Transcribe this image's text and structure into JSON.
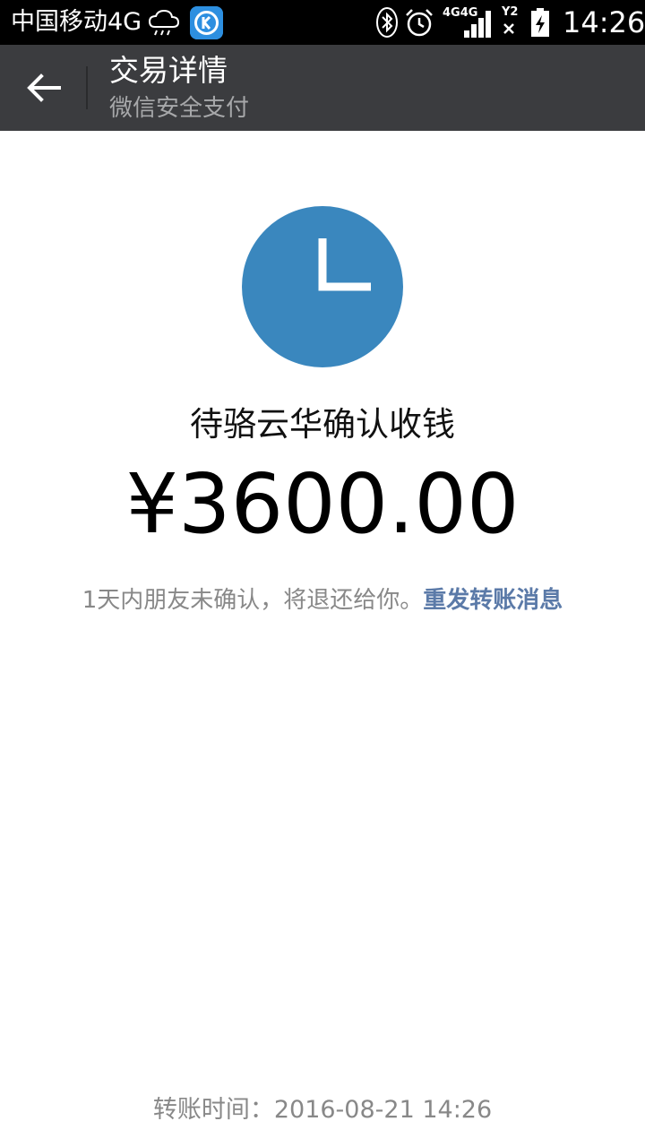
{
  "status_bar": {
    "carrier": "中国移动4G",
    "network": "4G4G",
    "sim_label": "Y2",
    "time": "14:26",
    "icons": [
      "weather-rain-icon",
      "app-k-icon",
      "bluetooth-icon",
      "alarm-icon",
      "signal-icon",
      "sim-icon",
      "battery-charging-icon"
    ]
  },
  "header": {
    "title": "交易详情",
    "subtitle": "微信安全支付"
  },
  "transfer": {
    "status_icon": "clock-icon",
    "status": "待骆云华确认收钱",
    "amount": "¥3600.00",
    "notice": "1天内朋友未确认，将退还给你。",
    "resend": "重发转账消息",
    "time_label": "转账时间：",
    "time": "2016-08-21 14:26"
  },
  "colors": {
    "status_bar": "#000000",
    "action_bar": "#3b3c3f",
    "accent": "#3a87be",
    "link": "#5b7aa8",
    "muted_text": "#888888"
  }
}
